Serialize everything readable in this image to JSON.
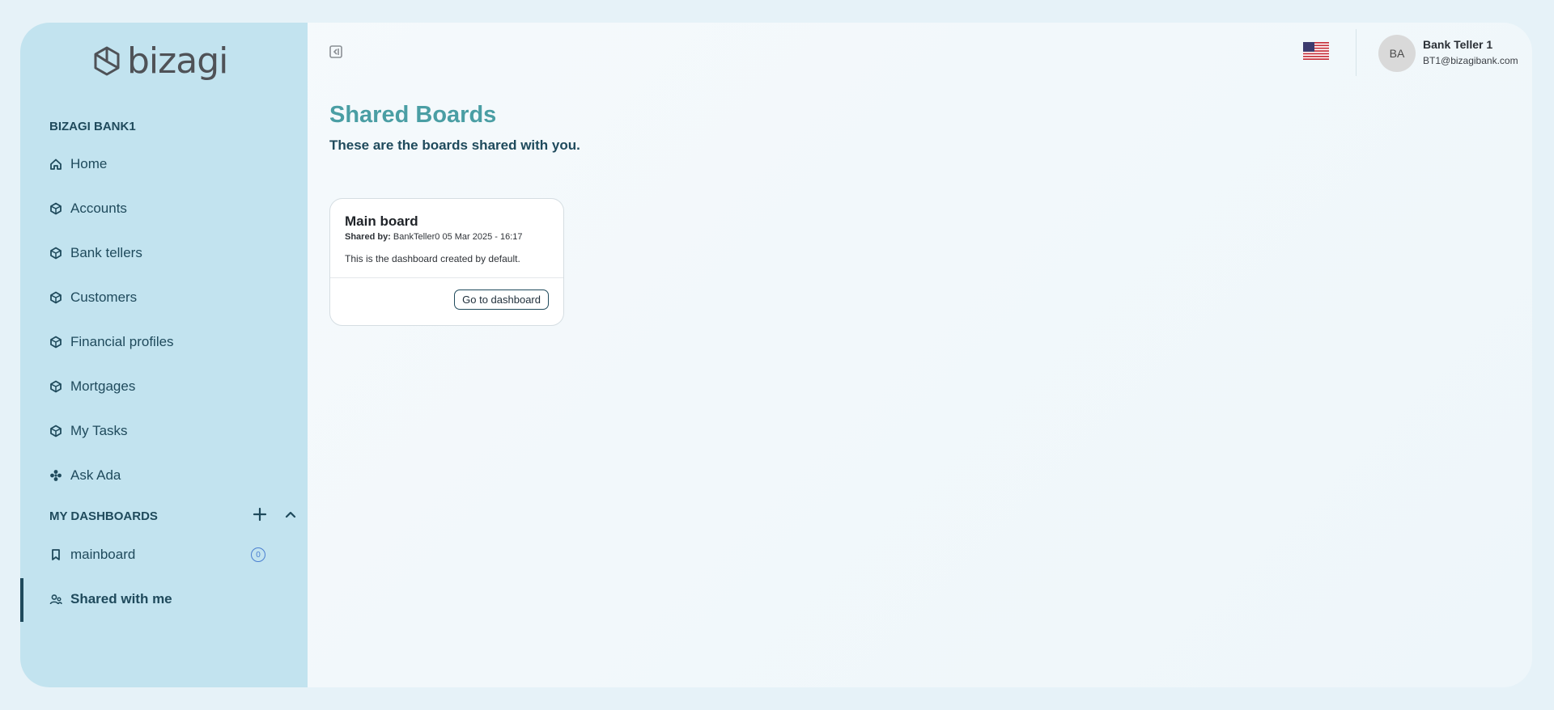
{
  "logo": {
    "text": "bizagi"
  },
  "sidebar": {
    "org_name": "BIZAGI BANK1",
    "items": [
      {
        "label": "Home",
        "icon": "home-icon"
      },
      {
        "label": "Accounts",
        "icon": "cube-icon"
      },
      {
        "label": "Bank tellers",
        "icon": "cube-icon"
      },
      {
        "label": "Customers",
        "icon": "cube-icon"
      },
      {
        "label": "Financial profiles",
        "icon": "cube-icon"
      },
      {
        "label": "Mortgages",
        "icon": "cube-icon"
      },
      {
        "label": "My Tasks",
        "icon": "cube-icon"
      },
      {
        "label": "Ask Ada",
        "icon": "sparkle-icon"
      }
    ],
    "dashboards_title": "MY DASHBOARDS",
    "dashboards": [
      {
        "label": "mainboard",
        "icon": "bookmark-icon",
        "count": "0"
      }
    ],
    "shared": {
      "label": "Shared with me",
      "icon": "shared-users-icon",
      "active": true
    }
  },
  "header": {
    "language_flag": "us-flag-icon",
    "user": {
      "initials": "BA",
      "name": "Bank Teller 1",
      "email": "BT1@bizagibank.com"
    }
  },
  "main": {
    "title": "Shared Boards",
    "subtitle": "These are the boards shared with you.",
    "boards": [
      {
        "title": "Main board",
        "shared_by_label": "Shared by:",
        "shared_by": "BankTeller0 05 Mar 2025 - 16:17",
        "description": "This is the dashboard created by default.",
        "button_label": "Go to dashboard"
      }
    ]
  },
  "colors": {
    "background": "#e6f2f8",
    "sidebar": "#c2e3ef",
    "title_accent": "#4a9ea4",
    "nav_text": "#1f4a5c"
  }
}
